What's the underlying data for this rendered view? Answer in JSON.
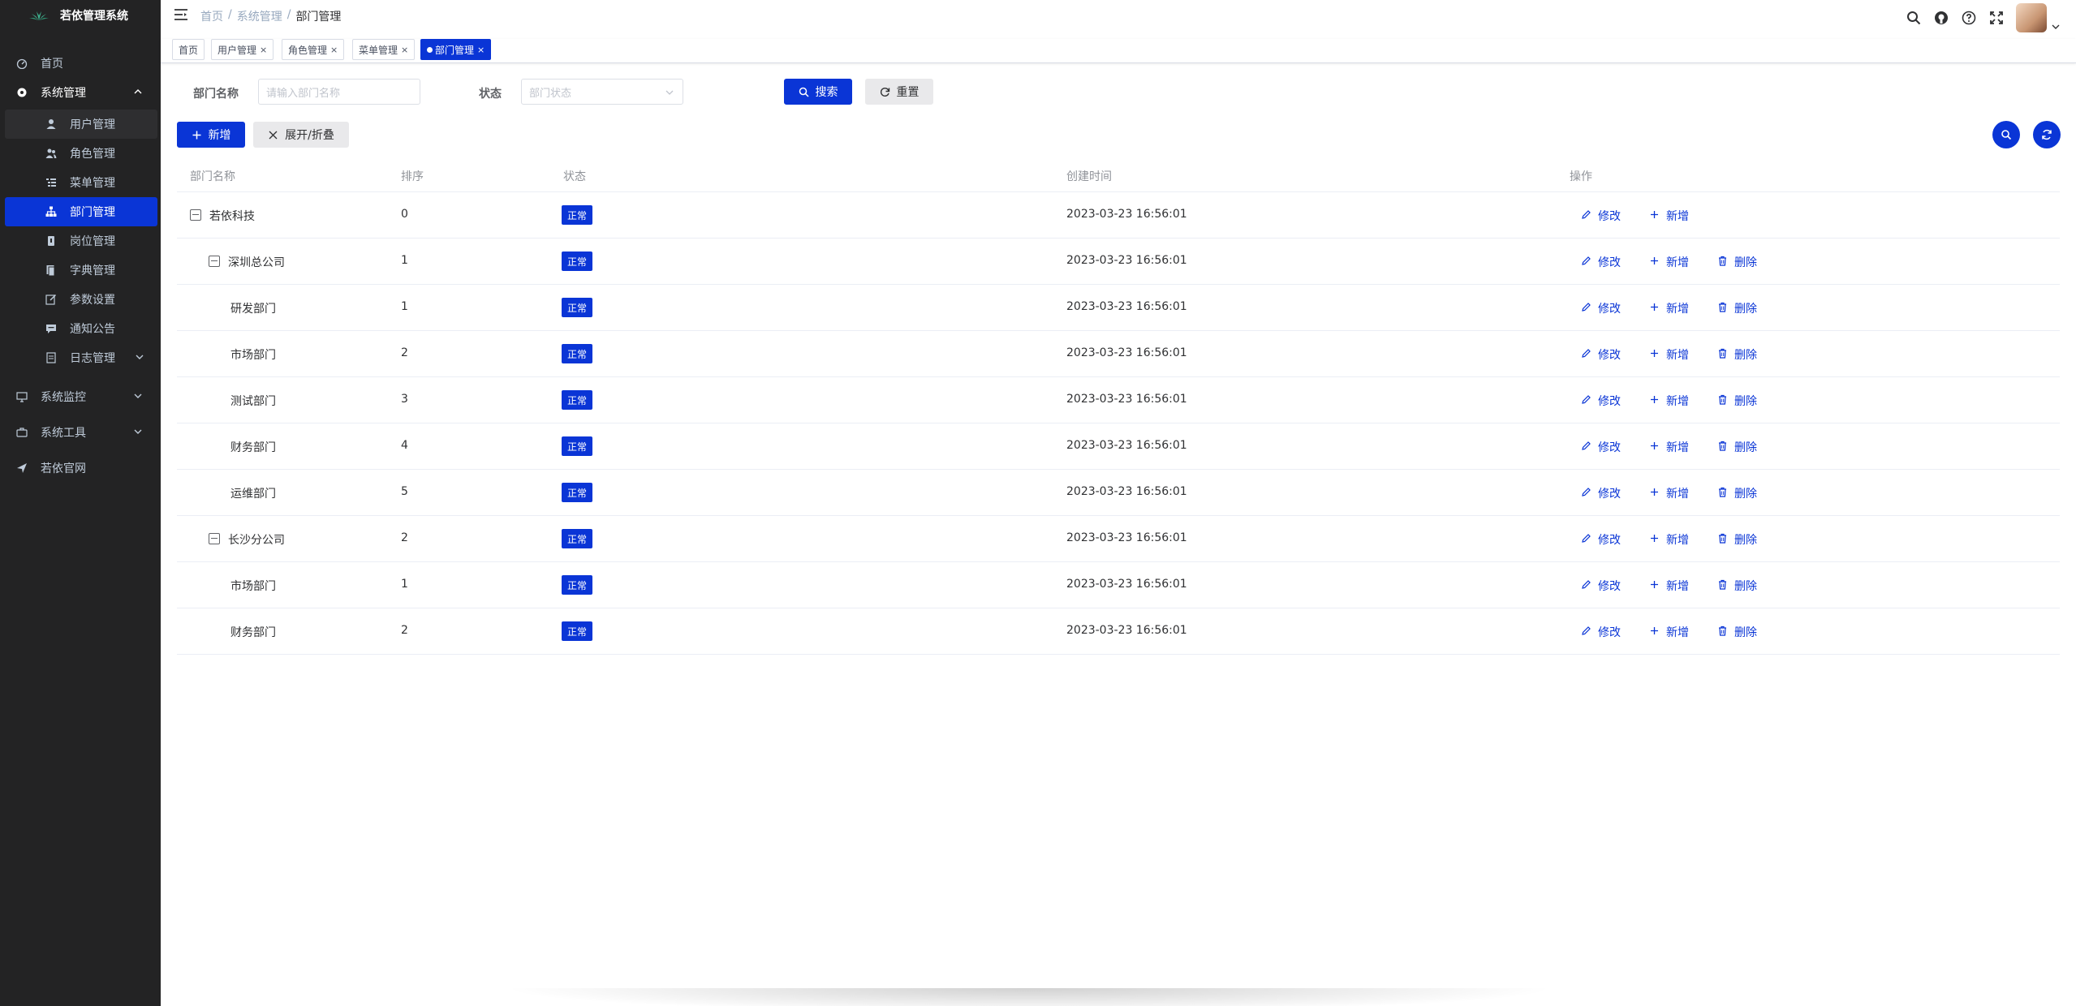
{
  "app": {
    "title": "若依管理系统"
  },
  "sidebar": {
    "items": [
      {
        "label": "首页",
        "icon": "dashboard-icon"
      },
      {
        "label": "系统管理",
        "icon": "gear-icon"
      },
      {
        "label": "用户管理",
        "icon": "user-icon"
      },
      {
        "label": "角色管理",
        "icon": "peoples-icon"
      },
      {
        "label": "菜单管理",
        "icon": "tree-table-icon"
      },
      {
        "label": "部门管理",
        "icon": "tree-icon"
      },
      {
        "label": "岗位管理",
        "icon": "post-icon"
      },
      {
        "label": "字典管理",
        "icon": "dict-icon"
      },
      {
        "label": "参数设置",
        "icon": "edit-icon"
      },
      {
        "label": "通知公告",
        "icon": "message-icon"
      },
      {
        "label": "日志管理",
        "icon": "log-icon"
      },
      {
        "label": "系统监控",
        "icon": "monitor-icon"
      },
      {
        "label": "系统工具",
        "icon": "tool-icon"
      },
      {
        "label": "若依官网",
        "icon": "guide-icon"
      }
    ]
  },
  "breadcrumb": {
    "home": "首页",
    "sep": "/",
    "parent": "系统管理",
    "current": "部门管理"
  },
  "tags": [
    {
      "label": "首页"
    },
    {
      "label": "用户管理",
      "close": "×"
    },
    {
      "label": "角色管理",
      "close": "×"
    },
    {
      "label": "菜单管理",
      "close": "×"
    },
    {
      "label": "部门管理",
      "close": "×"
    }
  ],
  "search": {
    "dept_name_label": "部门名称",
    "dept_name_placeholder": "请输入部门名称",
    "status_label": "状态",
    "status_placeholder": "部门状态",
    "search_button": "搜索",
    "reset_button": "重置"
  },
  "toolbar": {
    "add_button": "新增",
    "expand_button": "展开/折叠"
  },
  "table": {
    "headers": {
      "name": "部门名称",
      "order": "排序",
      "status": "状态",
      "created": "创建时间",
      "actions": "操作"
    },
    "actions": {
      "edit": "修改",
      "add": "新增",
      "delete": "删除"
    },
    "rows": [
      {
        "name": "若依科技",
        "order": "0",
        "status": "正常",
        "created": "2023-03-23 16:56:01"
      },
      {
        "name": "深圳总公司",
        "order": "1",
        "status": "正常",
        "created": "2023-03-23 16:56:01"
      },
      {
        "name": "研发部门",
        "order": "1",
        "status": "正常",
        "created": "2023-03-23 16:56:01"
      },
      {
        "name": "市场部门",
        "order": "2",
        "status": "正常",
        "created": "2023-03-23 16:56:01"
      },
      {
        "name": "测试部门",
        "order": "3",
        "status": "正常",
        "created": "2023-03-23 16:56:01"
      },
      {
        "name": "财务部门",
        "order": "4",
        "status": "正常",
        "created": "2023-03-23 16:56:01"
      },
      {
        "name": "运维部门",
        "order": "5",
        "status": "正常",
        "created": "2023-03-23 16:56:01"
      },
      {
        "name": "长沙分公司",
        "order": "2",
        "status": "正常",
        "created": "2023-03-23 16:56:01"
      },
      {
        "name": "市场部门",
        "order": "1",
        "status": "正常",
        "created": "2023-03-23 16:56:01"
      },
      {
        "name": "财务部门",
        "order": "2",
        "status": "正常",
        "created": "2023-03-23 16:56:01"
      }
    ]
  },
  "colors": {
    "primary": "#0a35d6",
    "sidebar_bg": "#232324"
  }
}
